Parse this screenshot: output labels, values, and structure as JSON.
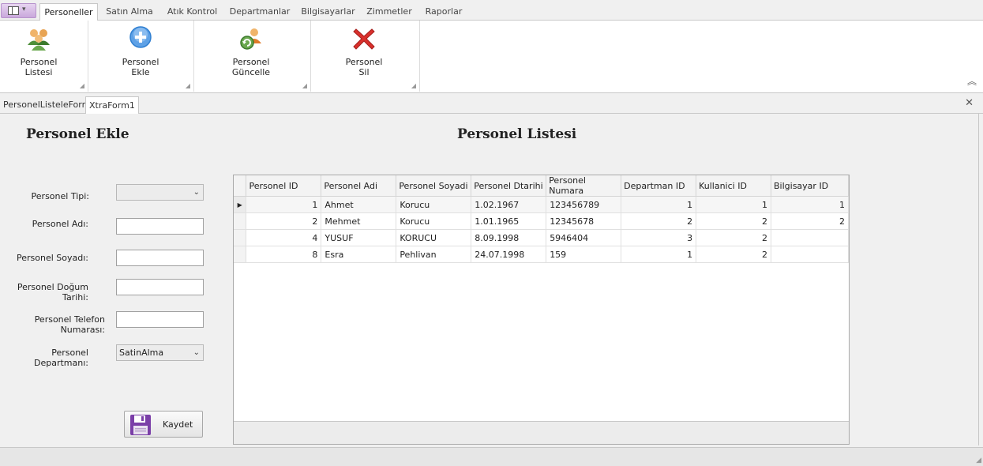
{
  "ribbon_tabs": [
    {
      "label": "Personeller",
      "active": true
    },
    {
      "label": "Satın Alma",
      "active": false
    },
    {
      "label": "Atık Kontrol",
      "active": false
    },
    {
      "label": "Departmanlar",
      "active": false
    },
    {
      "label": "Bilgisayarlar",
      "active": false
    },
    {
      "label": "Zimmetler",
      "active": false
    },
    {
      "label": "Raporlar",
      "active": false
    }
  ],
  "ribbon_buttons": [
    {
      "line1": "Personel",
      "line2": "Listesi",
      "icon": "users-icon"
    },
    {
      "line1": "Personel",
      "line2": "Ekle",
      "icon": "add-icon"
    },
    {
      "line1": "Personel",
      "line2": "Güncelle",
      "icon": "user-refresh-icon"
    },
    {
      "line1": "Personel",
      "line2": "Sil",
      "icon": "delete-icon"
    }
  ],
  "doc_tabs": [
    {
      "label": "PersonelListeleForm",
      "active": false
    },
    {
      "label": "XtraForm1",
      "active": true
    }
  ],
  "form": {
    "left_title": "Personel Ekle",
    "right_title": "Personel Listesi",
    "fields": {
      "tip_label": "Personel Tipi:",
      "tip_value": "",
      "adi_label": "Personel Adı:",
      "adi_value": "",
      "soyadi_label": "Personel Soyadı:",
      "soyadi_value": "",
      "dogum_label": "Personel Doğum Tarihi:",
      "dogum_value": "",
      "telefon_label": "Personel Telefon Numarası:",
      "telefon_value": "",
      "departman_label": "Personel Departmanı:",
      "departman_value": "SatinAlma"
    },
    "save_label": "Kaydet"
  },
  "grid": {
    "columns": [
      "Personel ID",
      "Personel Adi",
      "Personel Soyadi",
      "Personel Dtarihi",
      "Personel Numara",
      "Departman ID",
      "Kullanici ID",
      "Bilgisayar ID"
    ],
    "rows": [
      [
        "1",
        "Ahmet",
        "Korucu",
        "1.02.1967",
        "123456789",
        "1",
        "1",
        "1"
      ],
      [
        "2",
        "Mehmet",
        "Korucu",
        "1.01.1965",
        "12345678",
        "2",
        "2",
        "2"
      ],
      [
        "4",
        "YUSUF",
        "KORUCU",
        "8.09.1998",
        "5946404",
        "3",
        "2",
        ""
      ],
      [
        "8",
        "Esra",
        "Pehlivan",
        "24.07.1998",
        "159",
        "1",
        "2",
        ""
      ]
    ],
    "selected_row": 0
  },
  "colors": {
    "accent_purple": "#c9a8dc",
    "delete_red": "#d9302c",
    "add_blue": "#2f7fd1"
  }
}
